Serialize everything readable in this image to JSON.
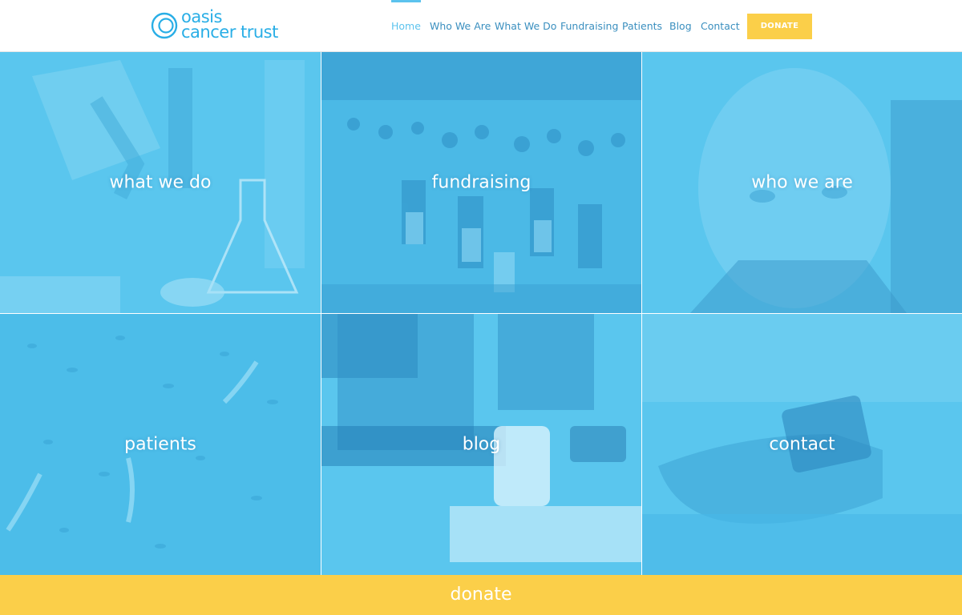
{
  "brand": {
    "line1": "oasis",
    "line2": "cancer trust",
    "color": "#29aee6"
  },
  "nav": {
    "items": [
      {
        "label": "Home",
        "active": true
      },
      {
        "label": "Who We Are"
      },
      {
        "label": "What We Do"
      },
      {
        "label": "Fundraising"
      },
      {
        "label": "Patients"
      },
      {
        "label": "Blog"
      },
      {
        "label": "Contact"
      }
    ],
    "donate_label": "DONATE"
  },
  "tiles": [
    {
      "label": "what we do",
      "icon": "laboratory-image"
    },
    {
      "label": "fundraising",
      "icon": "marathon-runners-image"
    },
    {
      "label": "who we are",
      "icon": "man-portrait-image"
    },
    {
      "label": "patients",
      "icon": "cell-tissue-image"
    },
    {
      "label": "blog",
      "icon": "desk-computer-image"
    },
    {
      "label": "contact",
      "icon": "hand-phone-image"
    }
  ],
  "footer": {
    "donate_label": "donate"
  },
  "colors": {
    "accent": "#5cc3ee",
    "tile_overlay": "#54c4ee",
    "donate": "#fbcf49"
  }
}
